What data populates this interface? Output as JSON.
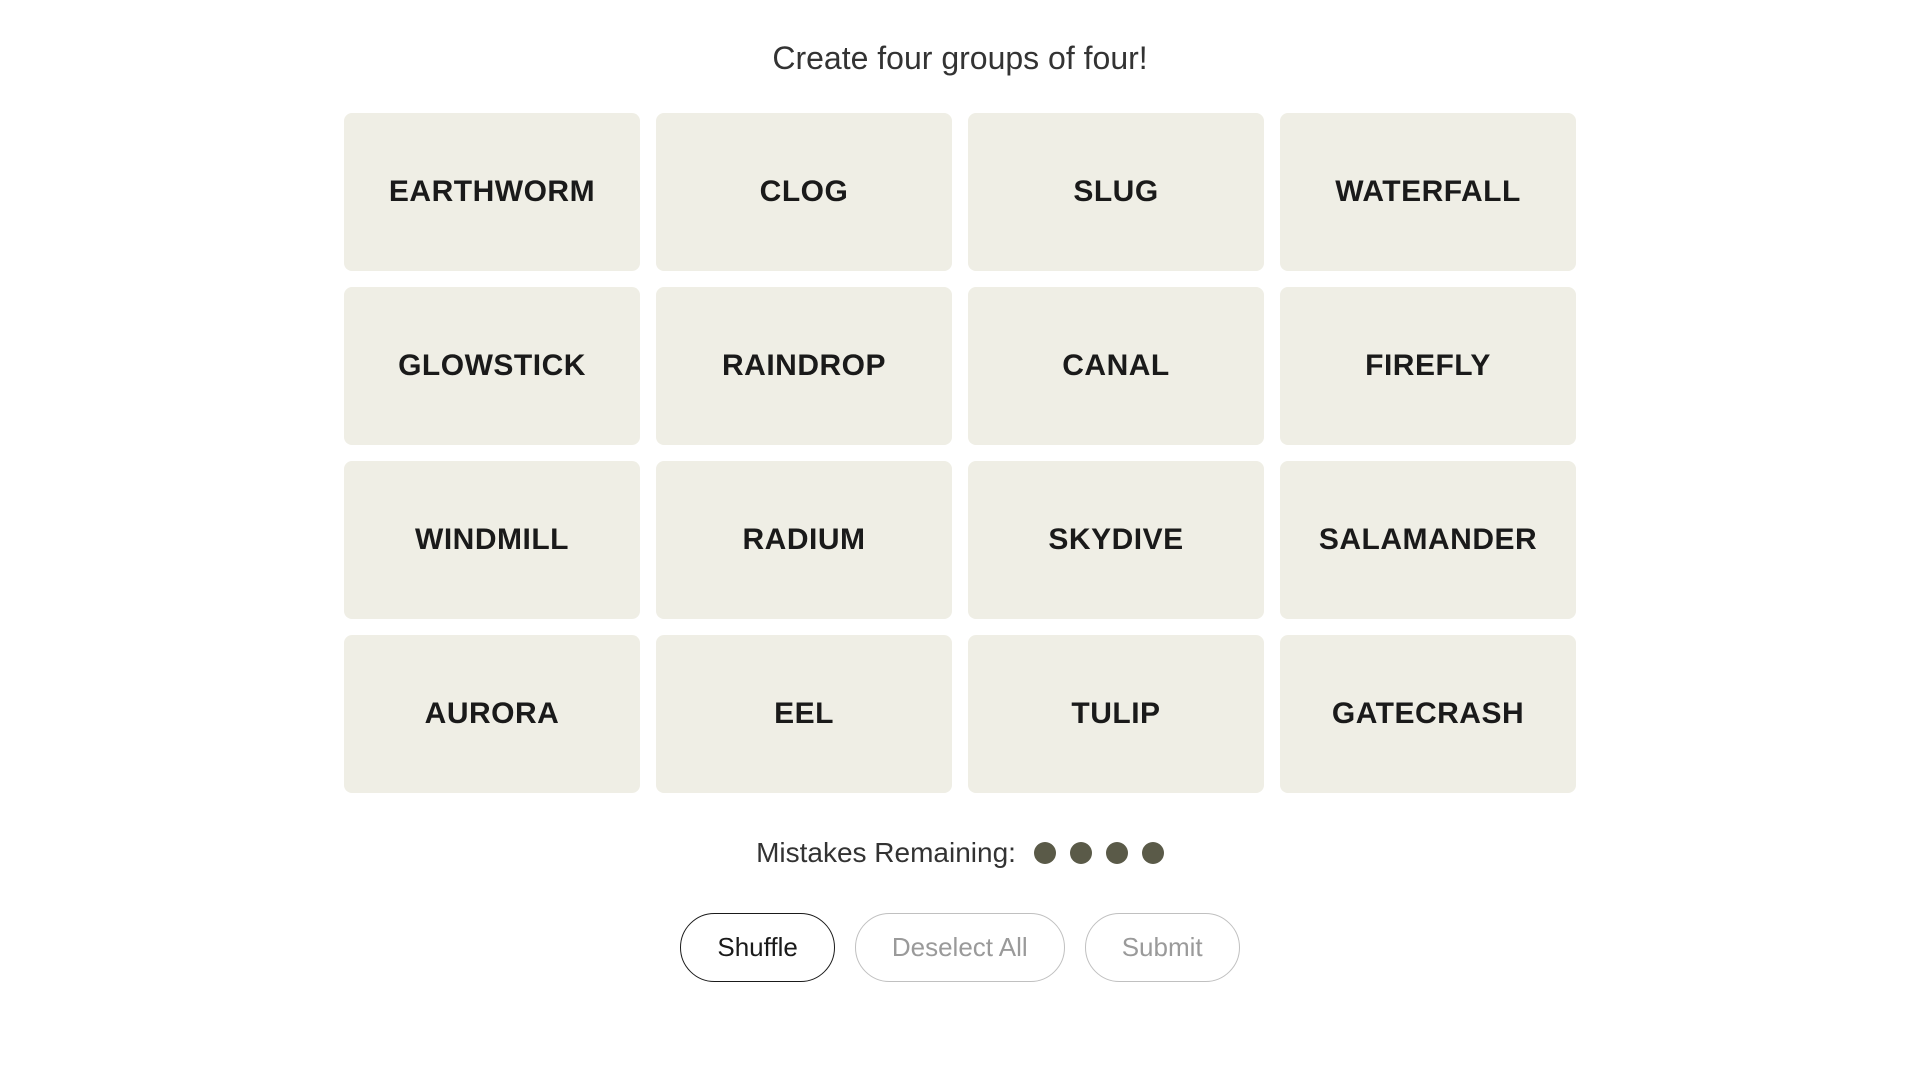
{
  "instruction": "Create four groups of four!",
  "tiles": [
    "EARTHWORM",
    "CLOG",
    "SLUG",
    "WATERFALL",
    "GLOWSTICK",
    "RAINDROP",
    "CANAL",
    "FIREFLY",
    "WINDMILL",
    "RADIUM",
    "SKYDIVE",
    "SALAMANDER",
    "AURORA",
    "EEL",
    "TULIP",
    "GATECRASH"
  ],
  "mistakes": {
    "label": "Mistakes Remaining:",
    "remaining": 4
  },
  "buttons": {
    "shuffle": "Shuffle",
    "deselect": "Deselect All",
    "submit": "Submit"
  }
}
